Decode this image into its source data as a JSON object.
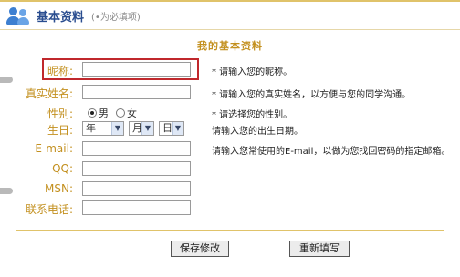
{
  "header": {
    "title": "基本资料",
    "note": "(•为必填项)"
  },
  "heading": "我的基本资料",
  "fields": {
    "nickname": {
      "label": "昵称:",
      "value": "",
      "hint": "* 请输入您的昵称。"
    },
    "realname": {
      "label": "真实姓名:",
      "value": "",
      "hint": "* 请输入您的真实姓名，以方便与您的同学沟通。"
    },
    "gender": {
      "label": "性别:",
      "hint": "* 请选择您的性别。",
      "options": [
        "男",
        "女"
      ],
      "selected": "男"
    },
    "birthday": {
      "label": "生日:",
      "year": "年",
      "month": "月",
      "day": "日",
      "hint": "请输入您的出生日期。"
    },
    "email": {
      "label": "E-mail:",
      "value": "",
      "hint": "请输入您常使用的E-mail，以做为您找回密码的指定邮箱。"
    },
    "qq": {
      "label": "QQ:",
      "value": ""
    },
    "msn": {
      "label": "MSN:",
      "value": ""
    },
    "phone": {
      "label": "联系电话:",
      "value": ""
    }
  },
  "buttons": {
    "save": "保存修改",
    "reset": "重新填写"
  },
  "colors": {
    "label": "#c3901f",
    "highlight": "#c0282c",
    "title": "#2a4d8f",
    "rule": "#e0c36a"
  },
  "icons": {
    "title_icon": "users-icon",
    "dropdown": "chevron-down-icon"
  }
}
